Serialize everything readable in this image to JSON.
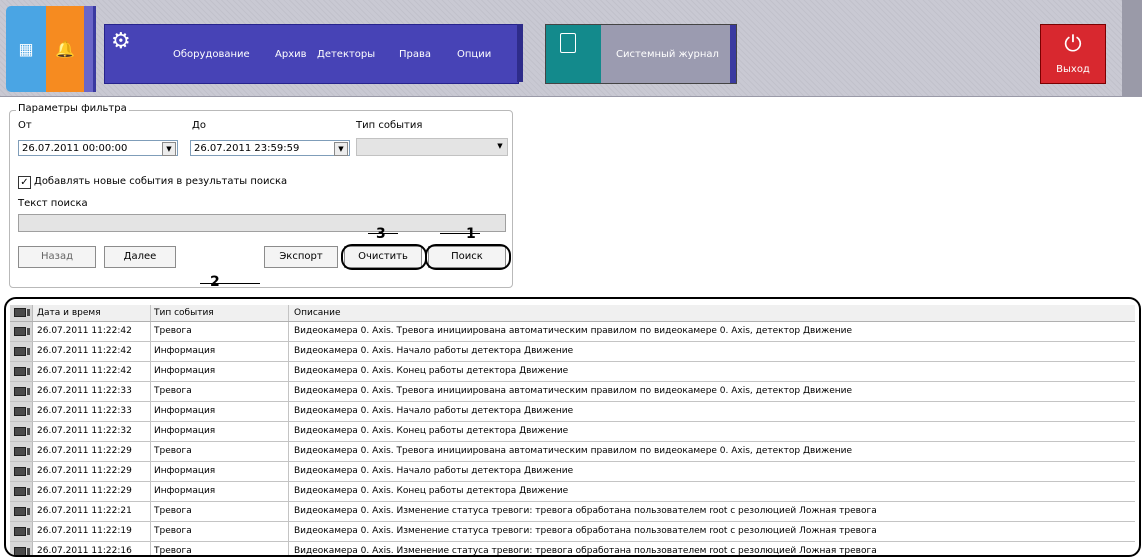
{
  "toolbar": {
    "menu": [
      "Оборудование",
      "Архив",
      "Детекторы",
      "Права",
      "Опции"
    ],
    "journal_label": "Системный журнал",
    "exit_label": "Выход"
  },
  "filter": {
    "group_title": "Параметры фильтра",
    "from_label": "От",
    "to_label": "До",
    "event_type_label": "Тип события",
    "from_value": "26.07.2011 00:00:00",
    "to_value": "26.07.2011 23:59:59",
    "event_type_value": "",
    "add_new_checked": true,
    "add_new_label": "Добавлять новые события в результаты поиска",
    "search_text_label": "Текст поиска",
    "search_text_value": ""
  },
  "buttons": {
    "back": "Назад",
    "next": "Далее",
    "export": "Экспорт",
    "clear": "Очистить",
    "search": "Поиск"
  },
  "callouts": {
    "search": "1",
    "table": "2",
    "clear": "3"
  },
  "table": {
    "columns": [
      "Дата и время",
      "Тип события",
      "Описание"
    ],
    "rows": [
      {
        "date": "26.07.2011 11:22:42",
        "type": "Тревога",
        "desc": "Видеокамера 0. Axis. Тревога инициирована автоматическим правилом по видеокамере 0. Axis, детектор Движение"
      },
      {
        "date": "26.07.2011 11:22:42",
        "type": "Информация",
        "desc": "Видеокамера 0. Axis. Начало работы детектора Движение"
      },
      {
        "date": "26.07.2011 11:22:42",
        "type": "Информация",
        "desc": "Видеокамера 0. Axis. Конец работы детектора Движение"
      },
      {
        "date": "26.07.2011 11:22:33",
        "type": "Тревога",
        "desc": "Видеокамера 0. Axis. Тревога инициирована автоматическим правилом по видеокамере 0. Axis, детектор Движение"
      },
      {
        "date": "26.07.2011 11:22:33",
        "type": "Информация",
        "desc": "Видеокамера 0. Axis. Начало работы детектора Движение"
      },
      {
        "date": "26.07.2011 11:22:32",
        "type": "Информация",
        "desc": "Видеокамера 0. Axis. Конец работы детектора Движение"
      },
      {
        "date": "26.07.2011 11:22:29",
        "type": "Тревога",
        "desc": "Видеокамера 0. Axis. Тревога инициирована автоматическим правилом по видеокамере 0. Axis, детектор Движение"
      },
      {
        "date": "26.07.2011 11:22:29",
        "type": "Информация",
        "desc": "Видеокамера 0. Axis. Начало работы детектора Движение"
      },
      {
        "date": "26.07.2011 11:22:29",
        "type": "Информация",
        "desc": "Видеокамера 0. Axis. Конец работы детектора Движение"
      },
      {
        "date": "26.07.2011 11:22:21",
        "type": "Тревога",
        "desc": "Видеокамера 0. Axis. Изменение статуса тревоги: тревога обработана  пользователем root с резолюцией Ложная тревога"
      },
      {
        "date": "26.07.2011 11:22:19",
        "type": "Тревога",
        "desc": "Видеокамера 0. Axis. Изменение статуса тревоги: тревога обработана  пользователем root с резолюцией Ложная тревога"
      },
      {
        "date": "26.07.2011 11:22:16",
        "type": "Тревога",
        "desc": "Видеокамера 0. Axis. Изменение статуса тревоги: тревога обработана  пользователем root с резолюцией Ложная тревога"
      }
    ]
  }
}
